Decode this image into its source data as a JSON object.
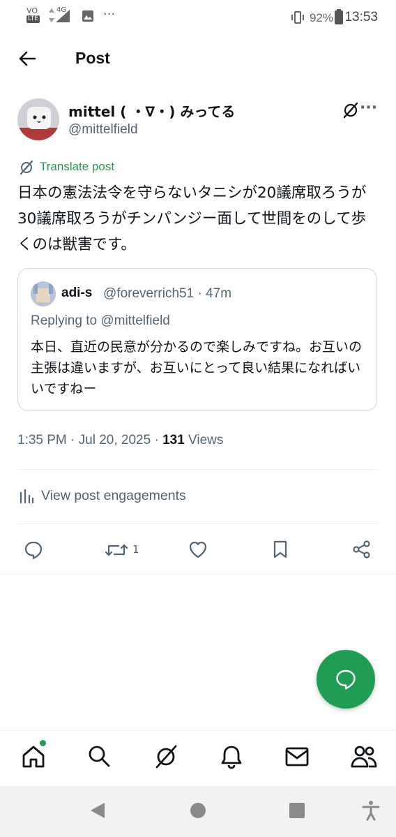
{
  "status_bar": {
    "network_top": "VO",
    "network_bottom": "LTE",
    "signal_label": "4G",
    "battery": "92%",
    "time": "13:53"
  },
  "header": {
    "title": "Post",
    "back_icon": "arrow-left-icon"
  },
  "post": {
    "display_name": "mittel ( ・∇・) みってる",
    "handle": "@mittelfield",
    "translate_label": "Translate post",
    "text": "日本の憲法法令を守らないタニシが20議席取ろうが30議席取ろうがチンパンジー面して世間をのして歩くのは獣害です。",
    "timestamp": "1:35 PM · Jul 20, 2025 · ",
    "views_count": "131",
    "views_label": " Views",
    "engagements_label": "View post engagements",
    "retweet_count": "1"
  },
  "quote": {
    "name": "adi-s",
    "handle_time": "@foreverrich51 · 47m",
    "replying_to": "Replying to @mittelfield",
    "text": "本日、直近の民意が分かるので楽しみですね。お互いの主張は違いますが、お互いにとって良い結果になればいいですねー"
  },
  "accent_color": "#1f9d55",
  "bottom_nav": [
    "home-icon",
    "search-icon",
    "grok-icon",
    "bell-icon",
    "mail-icon",
    "communities-icon"
  ]
}
